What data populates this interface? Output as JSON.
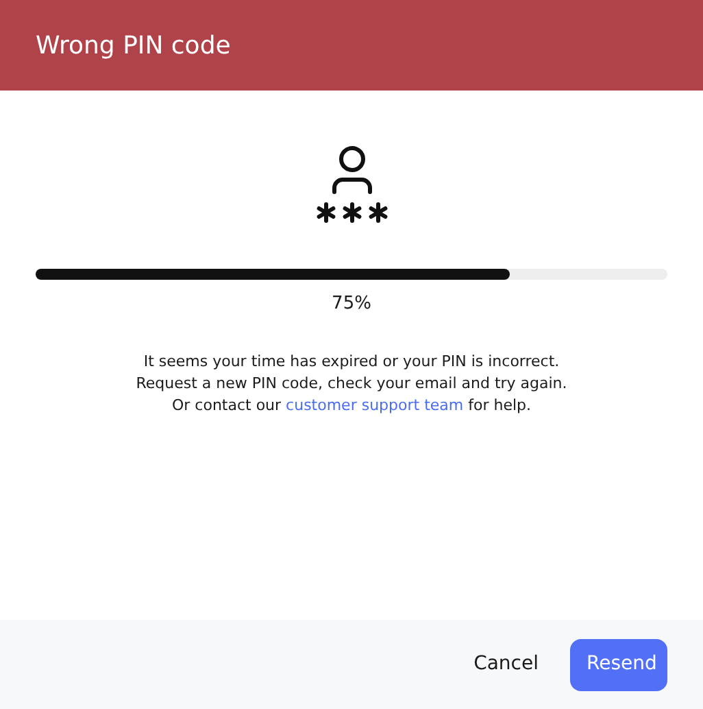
{
  "dialog": {
    "title": "Wrong PIN code"
  },
  "progress": {
    "level": 0.75,
    "reading": "75%"
  },
  "message": {
    "before": "It seems your time has expired or your PIN is incorrect. Request a new PIN code, check your email and try again. Or contact our ",
    "link": "customer support team",
    "after": " for help."
  },
  "buttons": [
    {
      "label": "Cancel",
      "kind": "secondary"
    },
    {
      "label": "Resend",
      "kind": "primary"
    }
  ]
}
